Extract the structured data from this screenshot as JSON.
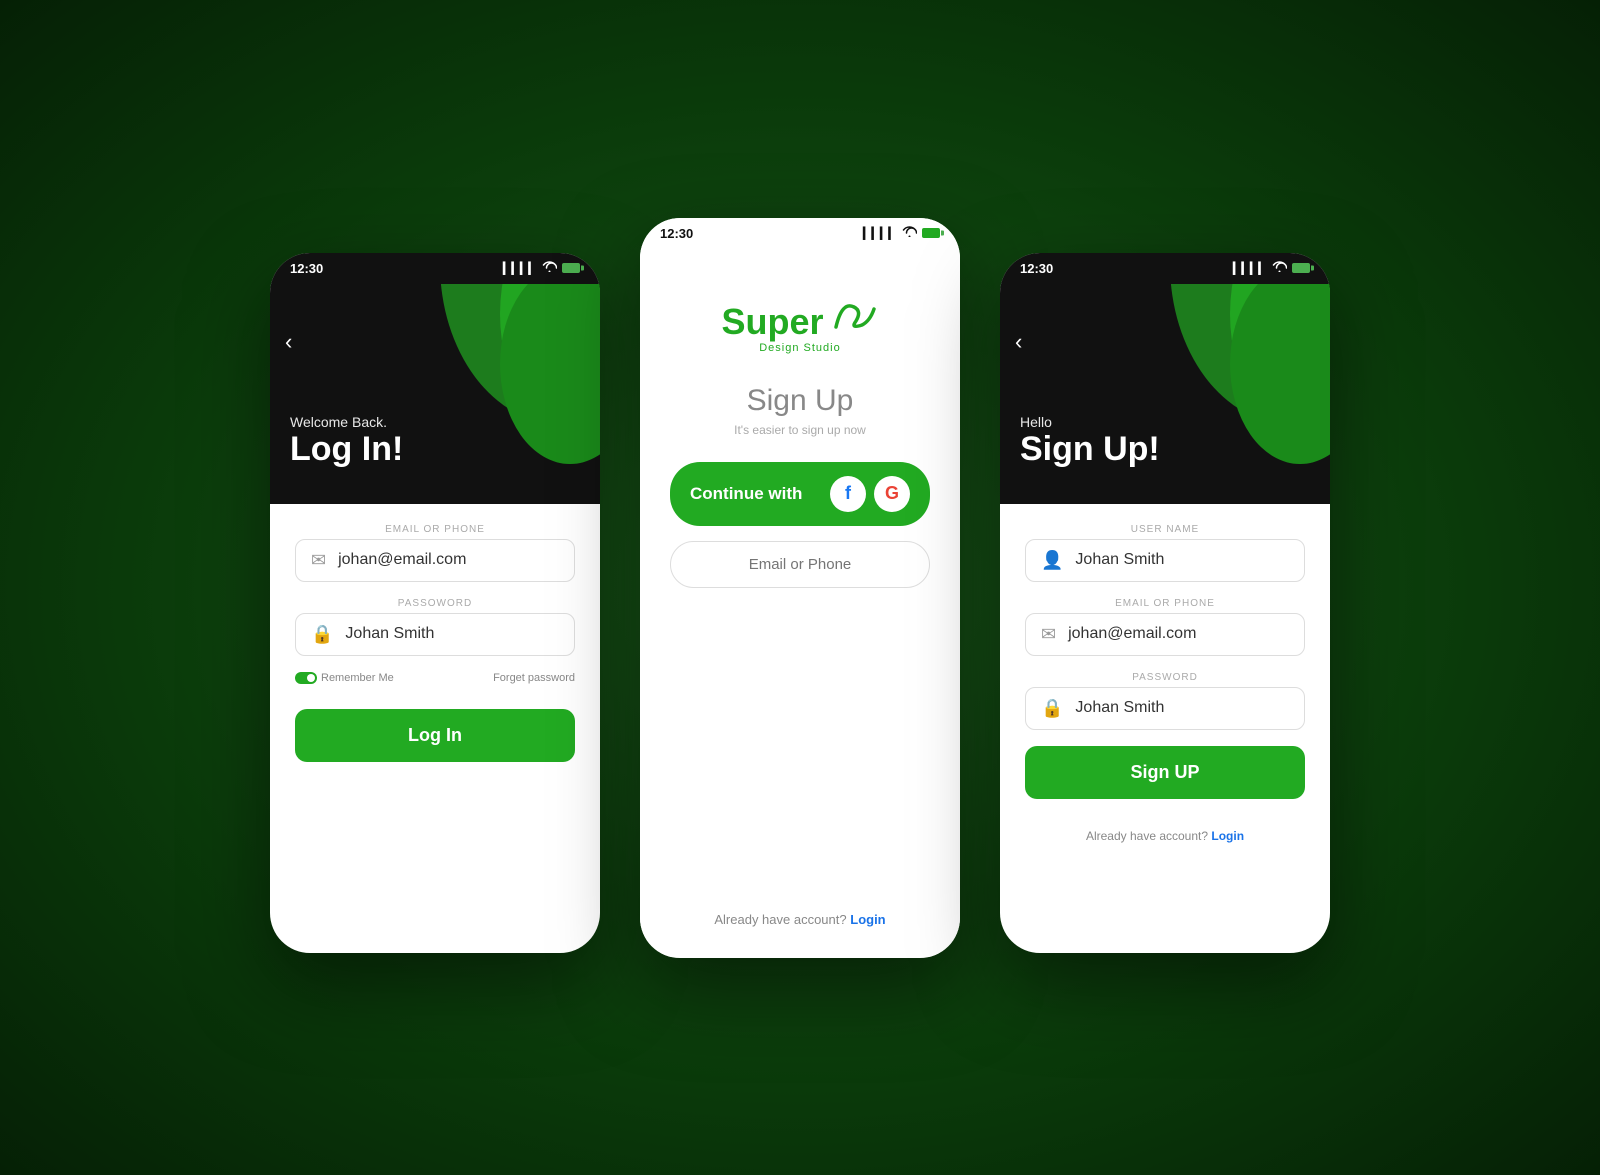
{
  "app": {
    "name": "SuperXu Design Studio"
  },
  "status_bar": {
    "time": "12:30",
    "signal": "▎▎▎▎",
    "wifi": "WiFi",
    "battery": "battery"
  },
  "left_phone": {
    "header": {
      "back_label": "‹",
      "subtitle": "Welcome Back.",
      "title": "Log In!"
    },
    "fields": {
      "email_label": "EMAIL OR PHONE",
      "email_value": "johan@email.com",
      "password_label": "PASSOWORD",
      "password_value": "Johan Smith"
    },
    "remember_me": "Remember Me",
    "forget_password": "Forget password",
    "button_label": "Log In"
  },
  "center_phone": {
    "logo_main": "Super",
    "logo_x": "xu",
    "logo_sub": "Design Studio",
    "heading": "Sign Up",
    "subheading": "It's easier to sign up now",
    "continue_label": "Continue with",
    "email_phone_placeholder": "Email or Phone",
    "already_text": "Already have account?",
    "login_link": "Login"
  },
  "right_phone": {
    "header": {
      "back_label": "‹",
      "subtitle": "Hello",
      "title": "Sign Up!"
    },
    "fields": {
      "username_label": "USER NAME",
      "username_value": "Johan Smith",
      "email_label": "EMAIL OR PHONE",
      "email_value": "johan@email.com",
      "password_label": "PASSWORD",
      "password_value": "Johan Smith"
    },
    "button_label": "Sign UP",
    "already_text": "Already have account?",
    "login_link": "Login"
  }
}
